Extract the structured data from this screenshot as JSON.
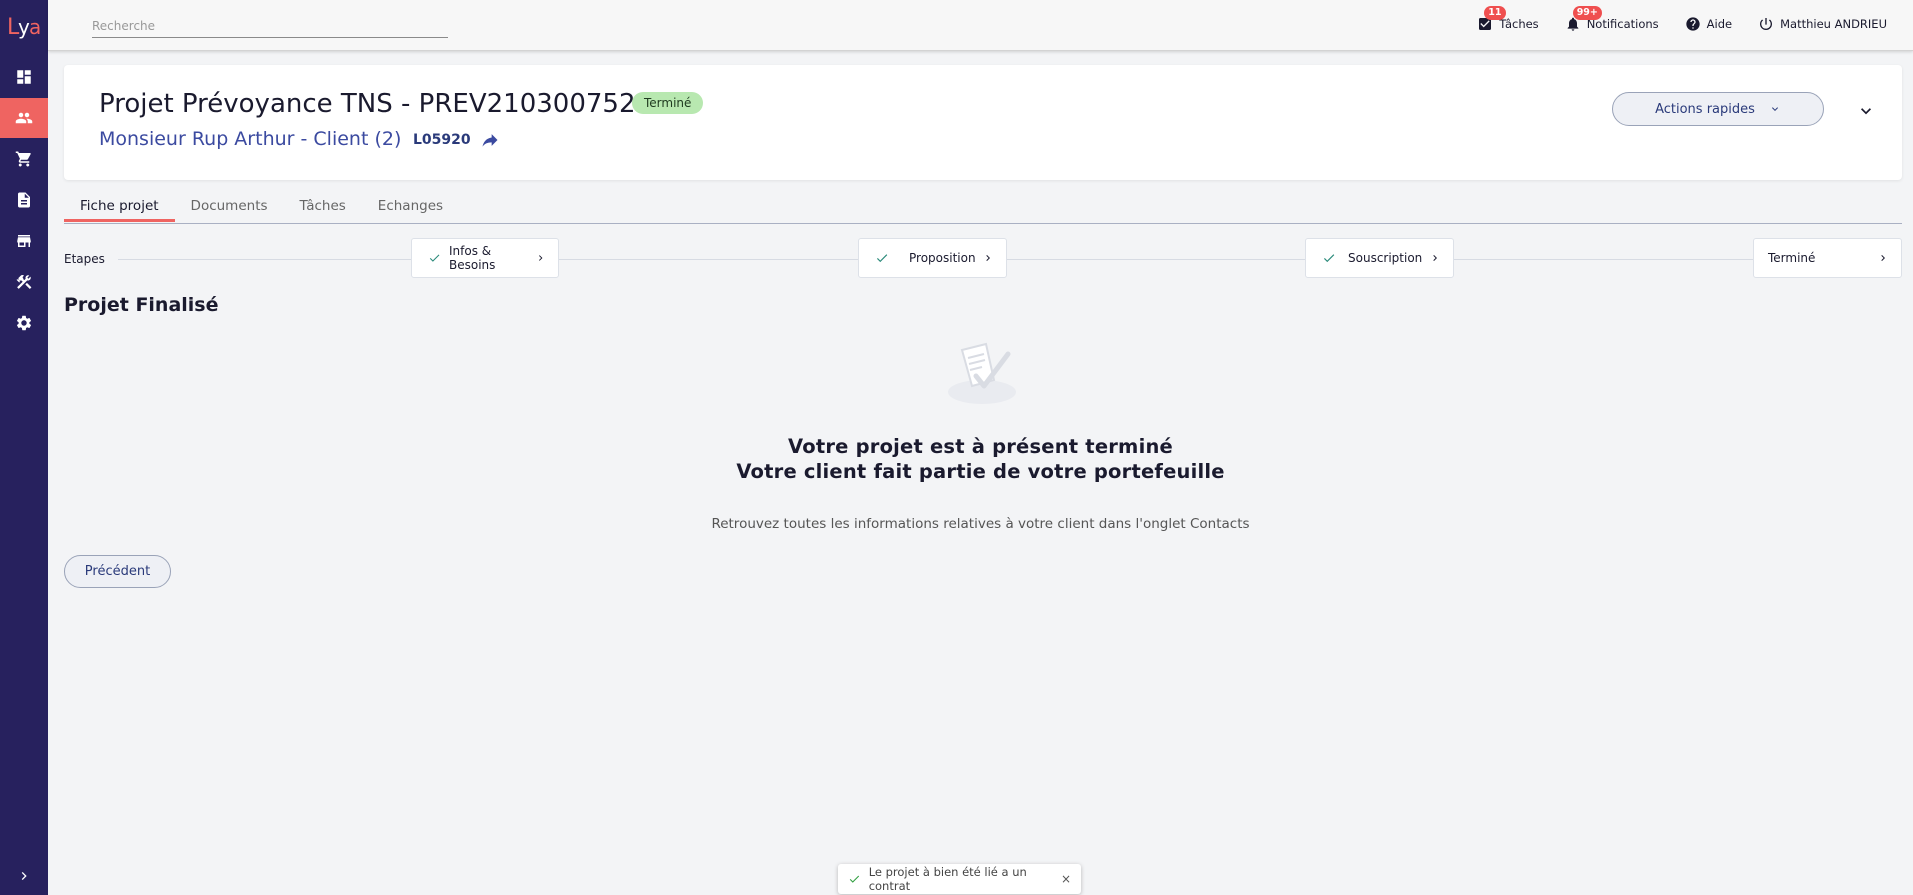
{
  "brand": {
    "logo_text": "Lya",
    "accent": "#ef6461",
    "sidebar_bg": "#27215e"
  },
  "sidebar": {
    "items": [
      {
        "name": "dashboard",
        "icon": "dashboard-icon",
        "active": false
      },
      {
        "name": "contacts",
        "icon": "people-icon",
        "active": true
      },
      {
        "name": "shop",
        "icon": "cart-icon",
        "active": false
      },
      {
        "name": "documents",
        "icon": "document-icon",
        "active": false
      },
      {
        "name": "store",
        "icon": "store-icon",
        "active": false
      },
      {
        "name": "tools",
        "icon": "tools-icon",
        "active": false
      },
      {
        "name": "settings",
        "icon": "gear-icon",
        "active": false
      }
    ]
  },
  "topbar": {
    "search_placeholder": "Recherche",
    "tasks_label": "Tâches",
    "tasks_badge": "11",
    "notifications_label": "Notifications",
    "notifications_badge": "99+",
    "help_label": "Aide",
    "user_label": "Matthieu ANDRIEU"
  },
  "project": {
    "title": "Projet Prévoyance TNS - PREV210300752",
    "status": "Terminé",
    "client_link": "Monsieur Rup Arthur - Client (2)",
    "client_code": "L05920",
    "actions_label": "Actions rapides"
  },
  "tabs": [
    {
      "label": "Fiche projet",
      "active": true
    },
    {
      "label": "Documents",
      "active": false
    },
    {
      "label": "Tâches",
      "active": false
    },
    {
      "label": "Echanges",
      "active": false
    }
  ],
  "steps": {
    "label": "Etapes",
    "items": [
      {
        "label": "Infos & Besoins",
        "done": true
      },
      {
        "label": "Proposition",
        "done": true
      },
      {
        "label": "Souscription",
        "done": true
      },
      {
        "label": "Terminé",
        "done": false
      }
    ]
  },
  "content": {
    "section_title": "Projet Finalisé",
    "message_line1": "Votre projet est à présent terminé",
    "message_line2": "Votre client fait partie de votre portefeuille",
    "message_sub": "Retrouvez toutes les informations relatives à votre client dans l'onglet Contacts",
    "prev_label": "Précédent"
  },
  "toast": {
    "message": "Le projet à bien été lié a un contrat",
    "close": "×"
  }
}
